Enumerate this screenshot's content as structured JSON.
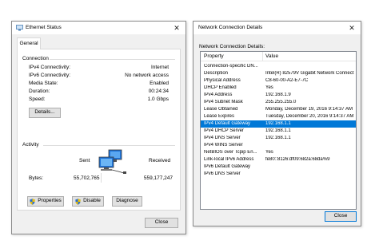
{
  "ethernet_status": {
    "title": "Ethernet Status",
    "tab": "General",
    "connection": {
      "heading": "Connection",
      "rows": [
        {
          "label": "IPv4 Connectivity:",
          "value": "Internet"
        },
        {
          "label": "IPv6 Connectivity:",
          "value": "No network access"
        },
        {
          "label": "Media State:",
          "value": "Enabled"
        },
        {
          "label": "Duration:",
          "value": "00:24:34"
        },
        {
          "label": "Speed:",
          "value": "1.0 Gbps"
        }
      ],
      "details_button": "Details..."
    },
    "activity": {
      "heading": "Activity",
      "sent_label": "Sent",
      "received_label": "Received",
      "bytes_label": "Bytes:",
      "bytes_sent": "55,702,765",
      "bytes_received": "559,177,247"
    },
    "buttons": {
      "properties": "Properties",
      "disable": "Disable",
      "diagnose": "Diagnose",
      "close": "Close"
    }
  },
  "connection_details": {
    "title": "Network Connection Details",
    "subtitle": "Network Connection Details:",
    "columns": {
      "property": "Property",
      "value": "Value"
    },
    "rows": [
      {
        "property": "Connection-specific DN...",
        "value": ""
      },
      {
        "property": "Description",
        "value": "Intel(R) 82579V Gigabit Network Connect"
      },
      {
        "property": "Physical Address",
        "value": "C8-60-00-A2-E7-7C"
      },
      {
        "property": "DHCP Enabled",
        "value": "Yes"
      },
      {
        "property": "IPv4 Address",
        "value": "192.168.1.9"
      },
      {
        "property": "IPv4 Subnet Mask",
        "value": "255.255.255.0"
      },
      {
        "property": "Lease Obtained",
        "value": "Monday, December 19, 2016 9:14:37 AM"
      },
      {
        "property": "Lease Expires",
        "value": "Tuesday, December 20, 2016 9:14:37 AM"
      },
      {
        "property": "IPv4 Default Gateway",
        "value": "192.168.1.1"
      },
      {
        "property": "IPv4 DHCP Server",
        "value": "192.168.1.1"
      },
      {
        "property": "IPv4 DNS Server",
        "value": "192.168.1.1"
      },
      {
        "property": "IPv4 WINS Server",
        "value": ""
      },
      {
        "property": "NetBIOS over Tcpip En...",
        "value": "Yes"
      },
      {
        "property": "Link-local IPv6 Address",
        "value": "fe80::8126:df09:682a:68da%9"
      },
      {
        "property": "IPv6 Default Gateway",
        "value": ""
      },
      {
        "property": "IPv6 DNS Server",
        "value": ""
      }
    ],
    "selected_row": 8,
    "close_button": "Close"
  },
  "colors": {
    "selection": "#0078d7",
    "window_bg": "#f0f0f0",
    "shield_blue": "#2b6fcf",
    "shield_yellow": "#f2c200"
  },
  "icons": [
    "ethernet-icon",
    "close-icon",
    "network-activity-icon",
    "shield-icon"
  ]
}
